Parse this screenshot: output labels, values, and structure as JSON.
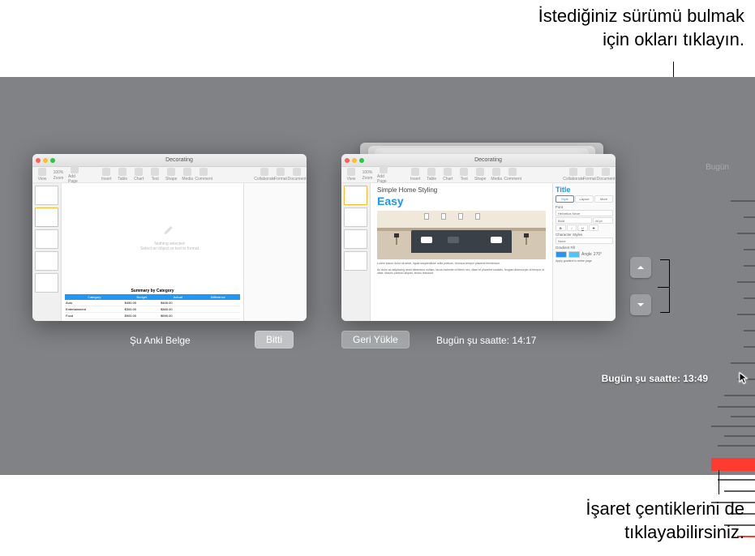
{
  "callouts": {
    "top_line1": "İstediğiniz sürümü bulmak",
    "top_line2": "için okları tıklayın.",
    "bottom_line1": "İşaret çentiklerini de",
    "bottom_line2": "tıklayabilirsiniz."
  },
  "timeline": {
    "today_label": "Bugün",
    "selected_label": "Bugün şu saatte: 13:49"
  },
  "buttons": {
    "done": "Bitti",
    "restore": "Geri Yükle"
  },
  "labels": {
    "current_document": "Şu Anki Belge",
    "version_time": "Bugün şu saatte: 14:17"
  },
  "window": {
    "title": "Decorating",
    "toolbar": {
      "view": "View",
      "zoom_value": "100%",
      "zoom": "Zoom",
      "add_page": "Add Page",
      "insert": "Insert",
      "table": "Table",
      "chart": "Chart",
      "text": "Text",
      "shape": "Shape",
      "media": "Media",
      "comment": "Comment",
      "collaborate": "Collaborate",
      "format": "Format",
      "document": "Document"
    },
    "left_canvas": {
      "nothing_title": "Nothing selected",
      "nothing_sub": "Select an object or text to format",
      "table_title": "Summary by Category",
      "headers": [
        "Category",
        "Budget",
        "Actual",
        "Difference"
      ],
      "rows": [
        [
          "Auto",
          "$450.00",
          "$465.00",
          ""
        ],
        [
          "Entertainment",
          "$300.00",
          "$360.00",
          ""
        ],
        [
          "Food",
          "$900.00",
          "$990.00",
          ""
        ]
      ]
    },
    "right_canvas": {
      "title": "Simple Home Styling",
      "subtitle": "Easy",
      "lorem1": "Lorem ipsum dolor sit amet, ligula suspendisse nulla pretium, rhoncus tempor placerat fermentum.",
      "lorem2": "Ac dolor ac adipiscing amet bibendum nullam, lacus molestie ut libero nec, diam et pharetra sodales, feugiat ullamcorper id tempor id vitae. Mauris pretium aliquet, lectus tincidunt."
    },
    "inspector": {
      "title": "Title",
      "seg_style": "Style",
      "seg_layout": "Layout",
      "seg_more": "More",
      "font_label": "Font",
      "font_name": "Helvetica Neue",
      "font_weight": "Bold",
      "font_size": "44 pt",
      "char_styles": "Character Styles",
      "char_value": "None",
      "fill_label": "Gradient Fill",
      "angle_label": "Angle",
      "angle_value": "270°",
      "gradient_hint": "Apply gradient to entire page"
    }
  }
}
